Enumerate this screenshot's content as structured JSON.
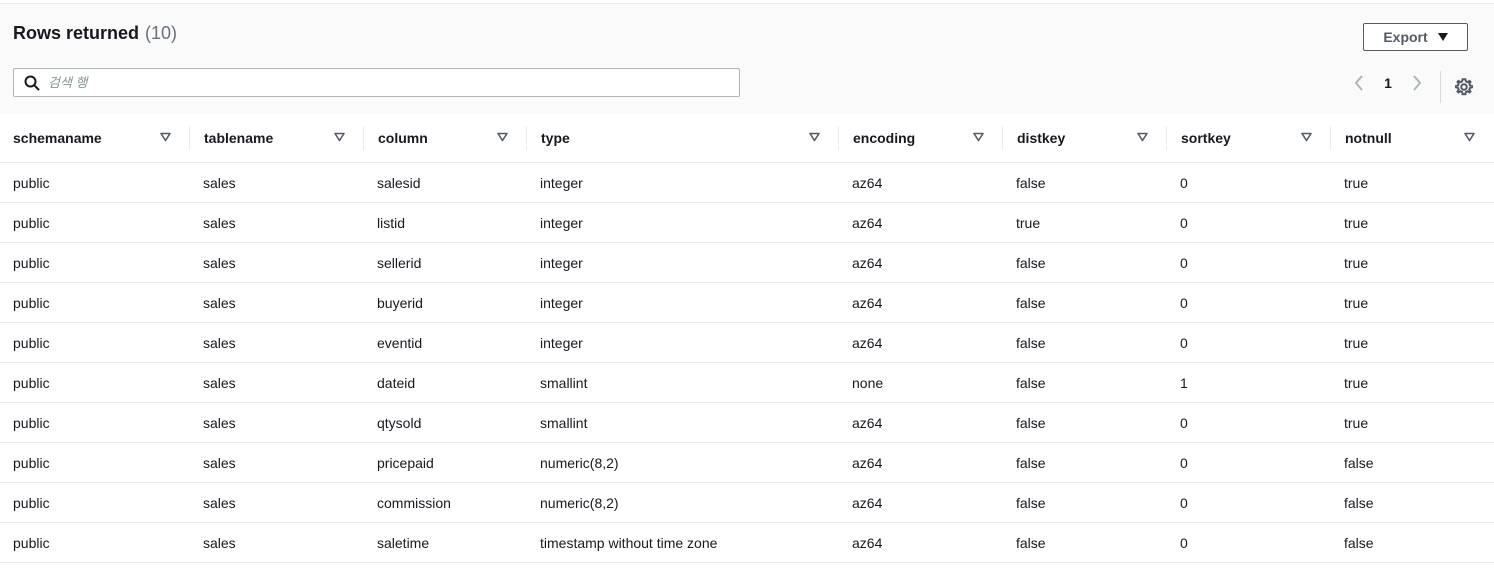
{
  "panel": {
    "title": "Rows returned",
    "row_count": "(10)",
    "export_label": "Export",
    "search": {
      "placeholder": "검색 행",
      "value": ""
    },
    "pagination": {
      "current_page": "1"
    }
  },
  "table": {
    "columns": [
      "schemaname",
      "tablename",
      "column",
      "type",
      "encoding",
      "distkey",
      "sortkey",
      "notnull"
    ],
    "rows": [
      [
        "public",
        "sales",
        "salesid",
        "integer",
        "az64",
        "false",
        "0",
        "true"
      ],
      [
        "public",
        "sales",
        "listid",
        "integer",
        "az64",
        "true",
        "0",
        "true"
      ],
      [
        "public",
        "sales",
        "sellerid",
        "integer",
        "az64",
        "false",
        "0",
        "true"
      ],
      [
        "public",
        "sales",
        "buyerid",
        "integer",
        "az64",
        "false",
        "0",
        "true"
      ],
      [
        "public",
        "sales",
        "eventid",
        "integer",
        "az64",
        "false",
        "0",
        "true"
      ],
      [
        "public",
        "sales",
        "dateid",
        "smallint",
        "none",
        "false",
        "1",
        "true"
      ],
      [
        "public",
        "sales",
        "qtysold",
        "smallint",
        "az64",
        "false",
        "0",
        "true"
      ],
      [
        "public",
        "sales",
        "pricepaid",
        "numeric(8,2)",
        "az64",
        "false",
        "0",
        "false"
      ],
      [
        "public",
        "sales",
        "commission",
        "numeric(8,2)",
        "az64",
        "false",
        "0",
        "false"
      ],
      [
        "public",
        "sales",
        "saletime",
        "timestamp without time zone",
        "az64",
        "false",
        "0",
        "false"
      ]
    ]
  },
  "icons": {
    "search": "search-icon",
    "export_caret": "caret-down-icon",
    "prev": "chevron-left-icon",
    "next": "chevron-right-icon",
    "settings": "gear-icon",
    "sort": "sort-triangle-icon"
  },
  "colors": {
    "header_bg": "#fafafa",
    "border": "#eaeded",
    "text": "#16191f",
    "muted": "#687078"
  }
}
